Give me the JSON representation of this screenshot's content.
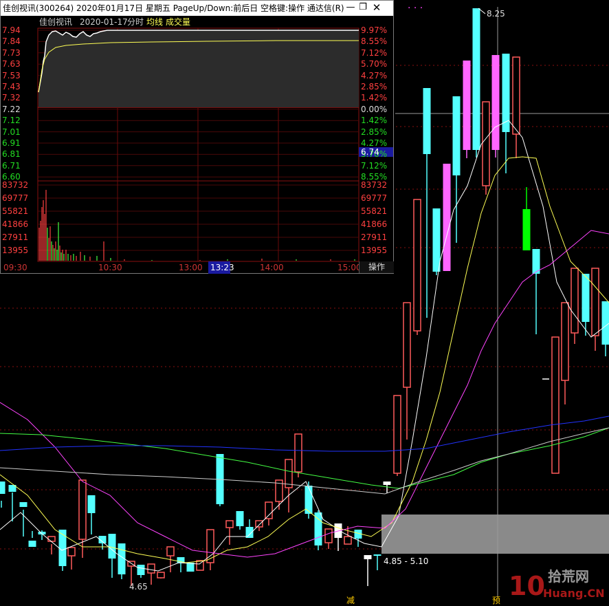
{
  "colors": {
    "up": "#ff5a5a",
    "up_strong": "#ff66ff",
    "down": "#54ffff",
    "limit_down": "#00ff00",
    "ma5": "#ffffff",
    "ma10": "#ffff55",
    "ma20": "#ff44ff",
    "ma60": "#44ff44",
    "ma120": "#2233ff",
    "ma250": "#cccccc",
    "grid": "#8a1010",
    "avg_line": "#ffff55",
    "price_line": "#ffffff",
    "volume_up": "#ff4040",
    "volume_down": "#44ff44"
  },
  "main_chart": {
    "high_label": "8.25",
    "low_label": "4.65",
    "range_label": "4.85 - 5.10",
    "marker_jian": "减",
    "marker_yu": "预",
    "top_dots": "·  ·  ·"
  },
  "watermark": {
    "logo_num": "10",
    "logo_cn": "拾荒网",
    "logo_en": "Huang.CN"
  },
  "popup": {
    "title": "佳创视讯(300264) 2020年01月17日 星期五 PageUp/Down:前后日 空格键:操作 通达信(R)",
    "min_icon": "minimize-icon",
    "restore_icon": "restore-icon",
    "close_icon": "close-icon",
    "info": {
      "name": "佳创视讯",
      "date": "2020-01-17",
      "mode": "分时",
      "avg_label": "均线",
      "vol_label": "成交量"
    },
    "price_levels": [
      "7.94",
      "7.84",
      "7.73",
      "7.63",
      "7.53",
      "7.43",
      "7.32",
      "7.22",
      "7.12",
      "7.01",
      "6.91",
      "6.81",
      "6.71",
      "6.60"
    ],
    "pct_levels": [
      "9.97%",
      "8.55%",
      "7.12%",
      "5.70%",
      "4.27%",
      "2.85%",
      "1.42%",
      "0.00%",
      "1.42%",
      "2.85%",
      "4.27%",
      "5.70%",
      "7.12%",
      "8.55%"
    ],
    "volume_levels": [
      "83732",
      "69777",
      "55821",
      "41866",
      "27911",
      "13955"
    ],
    "current_price": "6.74",
    "times": [
      "09:30",
      "10:30",
      "13:00",
      "13:23",
      "14:00",
      "15:00"
    ],
    "op_button": "操作"
  }
}
